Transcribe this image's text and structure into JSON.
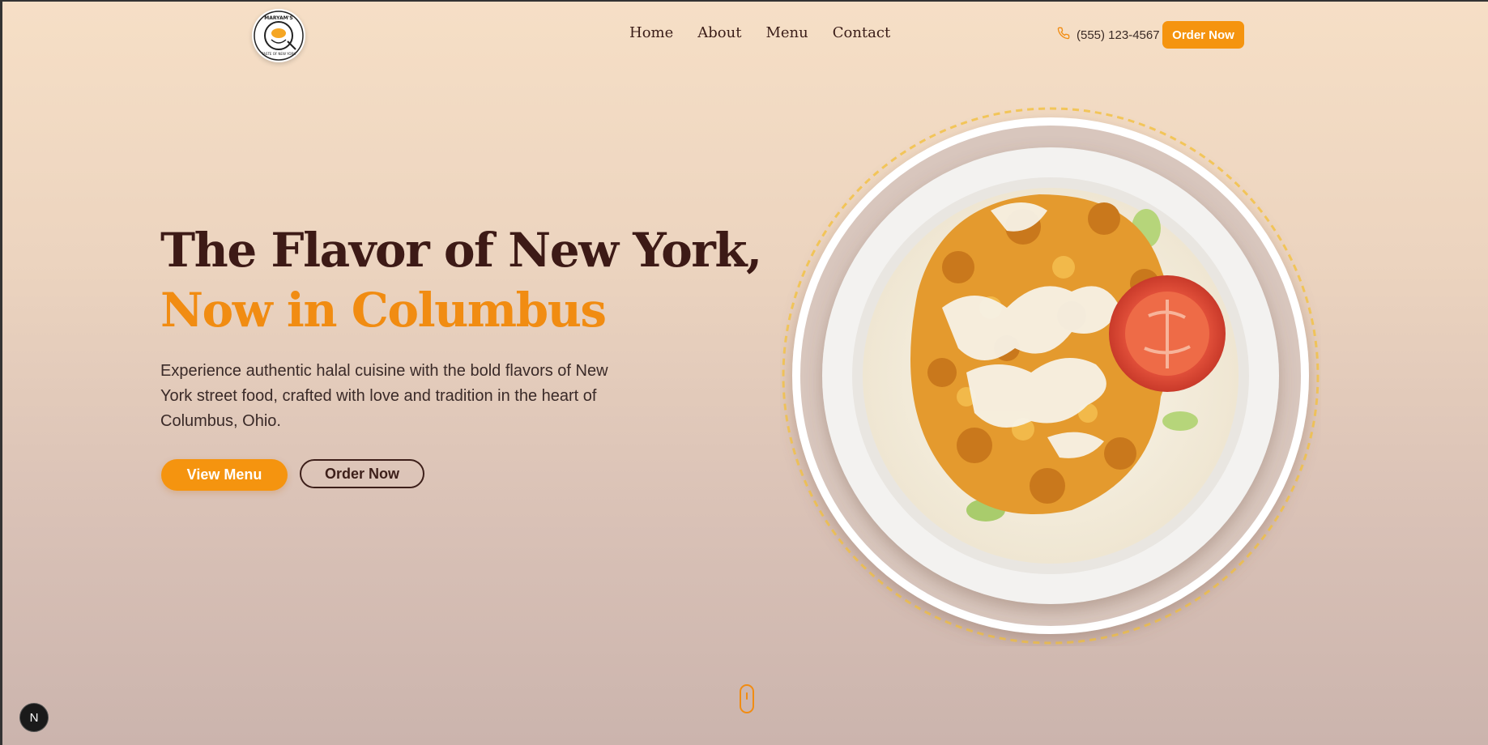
{
  "brand": {
    "logo_alt": "Maryam's Taste of New York logo",
    "logo_top_text": "MARYAM'S",
    "logo_bottom_text": "TASTE OF NEW YORK"
  },
  "nav": {
    "items": [
      {
        "label": "Home"
      },
      {
        "label": "About"
      },
      {
        "label": "Menu"
      },
      {
        "label": "Contact"
      }
    ]
  },
  "header": {
    "phone": "(555) 123-4567",
    "phone_icon": "phone-icon",
    "order_button": "Order Now"
  },
  "hero": {
    "title_line1": "The Flavor of New York,",
    "title_line2": "Now in Columbus",
    "description": "Experience authentic halal cuisine with the bold flavors of New York street food, crafted with love and tradition in the heart of Columbus, Ohio.",
    "primary_button": "View Menu",
    "secondary_button": "Order Now",
    "image_alt": "Chicken over rice bowl with white sauce and tomato"
  },
  "scroll_indicator": {
    "icon": "mouse-scroll-icon"
  },
  "dev_badge": {
    "label": "N"
  },
  "colors": {
    "accent": "#f5940f",
    "dark": "#3d1a16",
    "background_top": "#f6dfc6",
    "background_bottom": "#cbb4ad"
  }
}
